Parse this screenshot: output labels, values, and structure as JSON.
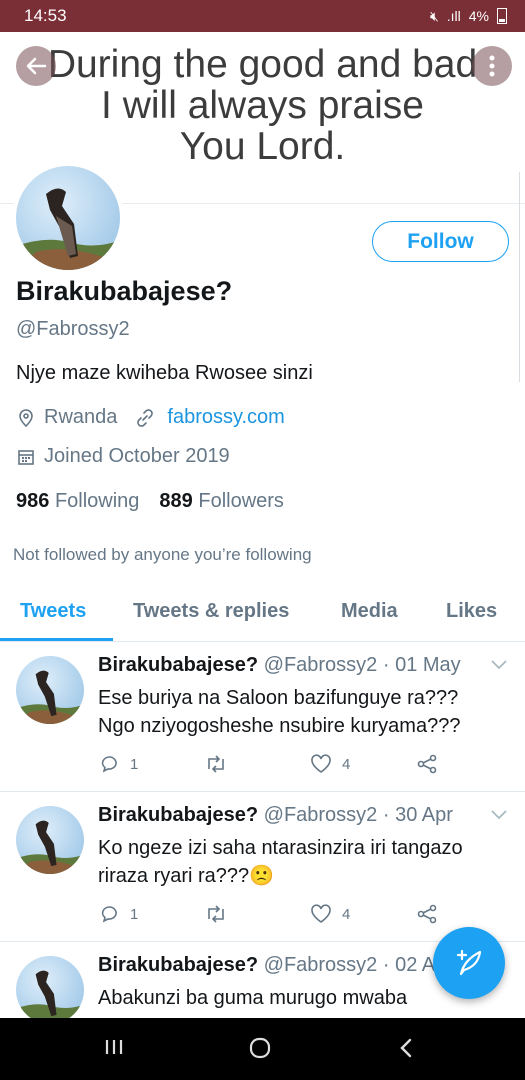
{
  "status_bar": {
    "time": "14:53",
    "battery": "4%"
  },
  "banner": {
    "text": "During the good and bad\nI will always praise\nYou Lord."
  },
  "profile": {
    "follow_label": "Follow",
    "name": "Birakubabajese?",
    "handle": "@Fabrossy2",
    "bio": "Njye maze kwiheba Rwosee sinzi",
    "location": "Rwanda",
    "website": "fabrossy.com",
    "joined": "Joined October 2019",
    "following_count": "986",
    "following_label": "Following",
    "followers_count": "889",
    "followers_label": "Followers",
    "not_followed": "Not followed by anyone you’re following"
  },
  "tabs": [
    {
      "label": "Tweets"
    },
    {
      "label": "Tweets & replies"
    },
    {
      "label": "Media"
    },
    {
      "label": "Likes"
    }
  ],
  "tweets": [
    {
      "name": "Birakubabajese?",
      "meta": " @Fabrossy2 · 01 May",
      "text": "Ese  buriya na Saloon bazifunguye ra???\nNgo nziyogosheshe nsubire kuryama???",
      "replies": "1",
      "likes": "4"
    },
    {
      "name": "Birakubabajese?",
      "meta": " @Fabrossy2 · 30 Apr",
      "text": "Ko ngeze izi saha ntarasinzira iri tangazo riraza ryari ra???🙁",
      "replies": "1",
      "likes": "4"
    },
    {
      "name": "Birakubabajese?",
      "meta": " @Fabrossy2 · 02 A",
      "text": "Abakunzi ba guma murugo mwaba",
      "replies": "",
      "likes": ""
    }
  ],
  "colors": {
    "accent": "#1da1f2",
    "status_bar": "#7a2e36",
    "secondary_text": "#657786"
  },
  "icons": [
    "back-arrow-icon",
    "more-icon",
    "location-pin-icon",
    "link-icon",
    "calendar-icon",
    "reply-icon",
    "retweet-icon",
    "like-icon",
    "share-icon",
    "compose-icon",
    "chevron-down-icon"
  ]
}
